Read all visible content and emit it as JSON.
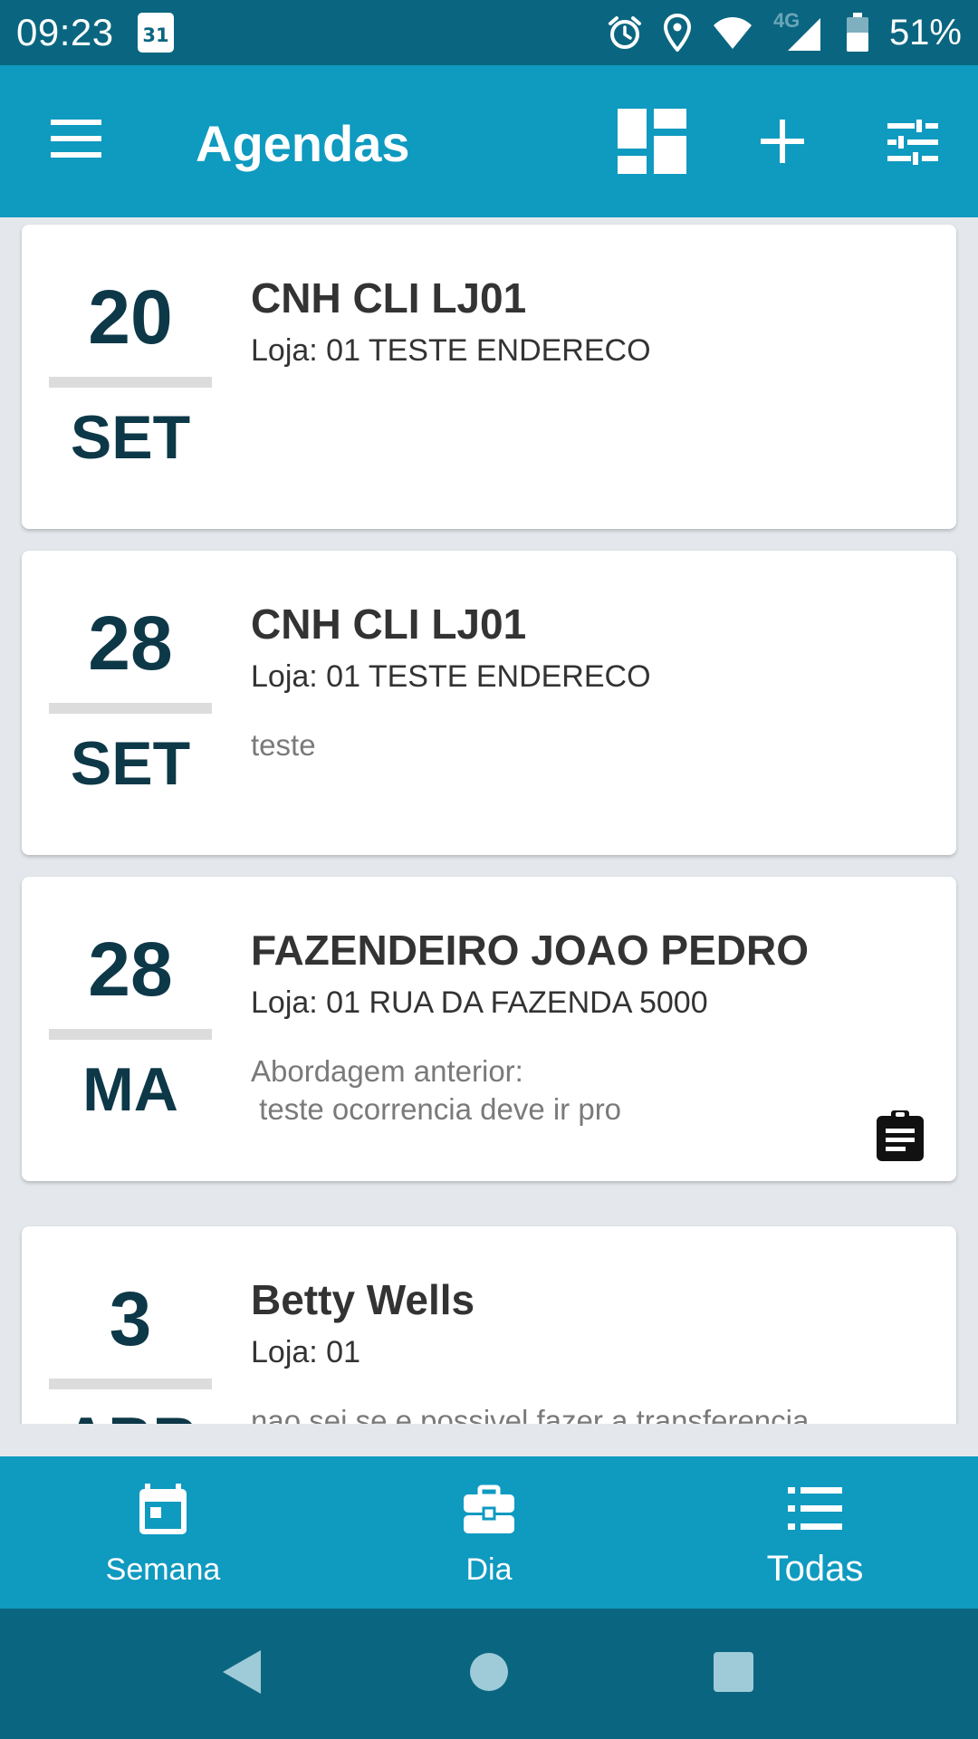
{
  "status_bar": {
    "time": "09:23",
    "calendar_day": "31",
    "network": "4G",
    "battery": "51%",
    "icons": [
      "calendar-icon",
      "alarm-icon",
      "location-icon",
      "wifi-icon",
      "signal-icon",
      "battery-icon"
    ]
  },
  "app_bar": {
    "title": "Agendas",
    "actions": [
      "menu-icon",
      "dashboard-icon",
      "add-icon",
      "tune-icon"
    ]
  },
  "agendas": [
    {
      "day": "20",
      "month": "SET",
      "title": "CNH CLI LJ01",
      "loja": "Loja: 01 TESTE ENDERECO",
      "note": "",
      "has_clipboard": false
    },
    {
      "day": "28",
      "month": "SET",
      "title": "CNH CLI LJ01",
      "loja": "Loja: 01 TESTE ENDERECO",
      "note": "teste",
      "has_clipboard": false
    },
    {
      "day": "28",
      "month": "MA",
      "title": "FAZENDEIRO JOAO PEDRO",
      "loja": "Loja: 01 RUA DA FAZENDA 5000",
      "note": "Abordagem anterior:\n teste ocorrencia deve ir pro",
      "has_clipboard": true
    },
    {
      "day": "3",
      "month": "ABR",
      "title": "Betty Wells",
      "loja": "Loja: 01",
      "note": "nao sei se e possivel fazer a transferencia",
      "has_clipboard": false
    }
  ],
  "bottom_nav": [
    {
      "label": "Semana",
      "icon": "calendar-week-icon",
      "active": false
    },
    {
      "label": "Dia",
      "icon": "briefcase-icon",
      "active": false
    },
    {
      "label": "Todas",
      "icon": "list-icon",
      "active": true
    }
  ],
  "system_nav": [
    "back-icon",
    "home-icon",
    "recents-icon"
  ],
  "colors": {
    "primary": "#0f9ac0",
    "primary_dark": "#0a6680",
    "date_text": "#0d3848",
    "background": "#e4e8ec"
  }
}
